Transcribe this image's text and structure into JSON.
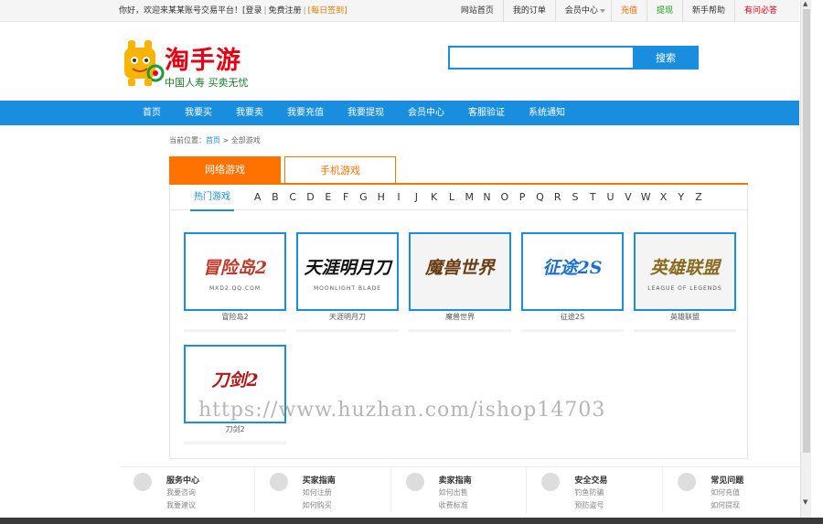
{
  "topbar": {
    "welcome": "你好，欢迎来某某账号交易平台！",
    "login": "[登录",
    "register": "免费注册",
    "signin": "[每日签到]",
    "links": [
      {
        "label": "网站首页",
        "style": ""
      },
      {
        "label": "我的订单",
        "style": ""
      },
      {
        "label": "会员中心",
        "style": "dropdown"
      },
      {
        "label": "充值",
        "style": "orange"
      },
      {
        "label": "提现",
        "style": "green"
      },
      {
        "label": "新手帮助",
        "style": ""
      },
      {
        "label": "有问必答",
        "style": "red"
      }
    ]
  },
  "logo": {
    "name": "淘手游",
    "slogan": "中国人寿 买卖无忧"
  },
  "search": {
    "value": "",
    "placeholder": "",
    "button": "搜索"
  },
  "nav": [
    "首页",
    "我要买",
    "我要卖",
    "我要充值",
    "我要提现",
    "会员中心",
    "客服验证",
    "系统通知"
  ],
  "breadcrumb": {
    "prefix": "当前位置：",
    "home": "首页",
    "current": " > 全部游戏"
  },
  "tabs": {
    "active": "网络游戏",
    "inactive": "手机游戏"
  },
  "filter": {
    "hot": "热门游戏",
    "letters": [
      "A",
      "B",
      "C",
      "D",
      "E",
      "F",
      "G",
      "H",
      "I",
      "J",
      "K",
      "L",
      "M",
      "N",
      "O",
      "P",
      "Q",
      "R",
      "S",
      "T",
      "U",
      "V",
      "W",
      "X",
      "Y",
      "Z"
    ]
  },
  "games": [
    {
      "name": "冒险岛2",
      "logo_text": "冒险岛2",
      "sub": "MXD2.QQ.COM",
      "bg": "#ffffff",
      "fg": "#c0392b"
    },
    {
      "name": "天涯明月刀",
      "logo_text": "天涯明月刀",
      "sub": "MOONLIGHT BLADE",
      "bg": "#ffffff",
      "fg": "#111111"
    },
    {
      "name": "魔兽世界",
      "logo_text": "魔兽世界",
      "sub": "",
      "bg": "#f4f4f4",
      "fg": "#6b3d12"
    },
    {
      "name": "征途2S",
      "logo_text": "征途2S",
      "sub": "",
      "bg": "#ffffff",
      "fg": "#1a6fd0"
    },
    {
      "name": "英雄联盟",
      "logo_text": "英雄联盟",
      "sub": "LEAGUE OF LEGENDS",
      "bg": "#f4f4f4",
      "fg": "#8a6a1e"
    },
    {
      "name": "刀剑2",
      "logo_text": "刀剑2",
      "sub": "",
      "bg": "#ffffff",
      "fg": "#b01818"
    }
  ],
  "watermark": "https://www.huzhan.com/ishop14703",
  "footer": [
    {
      "title": "服务中心",
      "links": [
        "我要咨询",
        "我要建议"
      ],
      "icon": "compass-icon"
    },
    {
      "title": "买家指南",
      "links": [
        "如何注册",
        "如何购买"
      ],
      "icon": "cart-icon"
    },
    {
      "title": "卖家指南",
      "links": [
        "如何出售",
        "收费标准"
      ],
      "icon": "wallet-icon"
    },
    {
      "title": "安全交易",
      "links": [
        "钓鱼防骗",
        "预防盗号"
      ],
      "icon": "wrench-icon"
    },
    {
      "title": "常见问题",
      "links": [
        "如何充值",
        "如何提现"
      ],
      "icon": "heart-icon"
    }
  ],
  "colors": {
    "brand_blue": "#1a8ede",
    "tab_orange": "#ff7200",
    "logo_red": "#e60012"
  }
}
